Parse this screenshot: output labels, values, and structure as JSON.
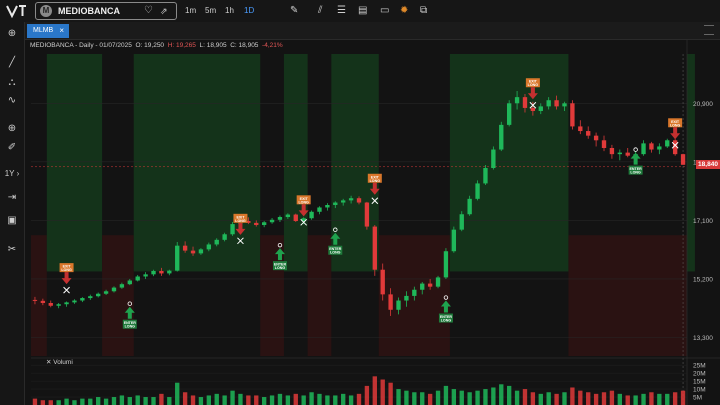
{
  "header": {
    "symbol_badge": "M",
    "symbol": "MEDIOBANCA",
    "timeframes": [
      "1m",
      "5m",
      "1h",
      "1D"
    ],
    "active_timeframe": "1D"
  },
  "tab": {
    "label": "MLMB",
    "close": "×"
  },
  "legend": {
    "name": "MEDIOBANCA - Daily - 01/07/2025",
    "open": "O: 19,250",
    "high": "H: 19,265",
    "low": "L: 18,905",
    "close": "C: 18,905",
    "change": "-4,21%"
  },
  "volume_title": "Volumi",
  "last_price": "18,840",
  "signals": {
    "exit": "EXIT LONG",
    "enter": "ENTER LONG"
  },
  "colors": {
    "up": "#1fb85a",
    "down": "#e03a3a",
    "accent": "#2a77c9",
    "long_zone": "#14331a",
    "short_zone": "#2a1212"
  },
  "chart_data": {
    "type": "candlestick",
    "title": "MEDIOBANCA - Daily",
    "y_axis_labels": [
      "20,900",
      "19,000",
      "17,100",
      "15,200",
      "13,300"
    ],
    "volume_axis_labels": [
      "25M",
      "20M",
      "15M",
      "10M",
      "5M"
    ],
    "ylim": [
      12700,
      22500
    ],
    "last_value": 18840,
    "series": {
      "candles": [
        [
          14520,
          14620,
          14380,
          14490
        ],
        [
          14490,
          14560,
          14350,
          14420
        ],
        [
          14420,
          14500,
          14280,
          14330
        ],
        [
          14330,
          14420,
          14250,
          14380
        ],
        [
          14380,
          14470,
          14300,
          14440
        ],
        [
          14440,
          14540,
          14390,
          14500
        ],
        [
          14500,
          14610,
          14450,
          14580
        ],
        [
          14580,
          14690,
          14520,
          14640
        ],
        [
          14640,
          14760,
          14600,
          14720
        ],
        [
          14720,
          14850,
          14680,
          14800
        ],
        [
          14800,
          14960,
          14760,
          14920
        ],
        [
          14920,
          15080,
          14880,
          15030
        ],
        [
          15030,
          15200,
          15000,
          15150
        ],
        [
          15150,
          15330,
          15120,
          15280
        ],
        [
          15280,
          15420,
          15200,
          15350
        ],
        [
          15350,
          15500,
          15290,
          15460
        ],
        [
          15460,
          15560,
          15300,
          15380
        ],
        [
          15380,
          15500,
          15320,
          15470
        ],
        [
          15470,
          16400,
          15440,
          16280
        ],
        [
          16280,
          16420,
          16050,
          16120
        ],
        [
          16120,
          16250,
          15950,
          16030
        ],
        [
          16030,
          16200,
          15980,
          16160
        ],
        [
          16160,
          16380,
          16100,
          16320
        ],
        [
          16320,
          16520,
          16260,
          16470
        ],
        [
          16470,
          16700,
          16420,
          16650
        ],
        [
          16650,
          17050,
          16600,
          16980
        ],
        [
          16980,
          17150,
          16900,
          17080
        ],
        [
          17080,
          17200,
          16980,
          17020
        ],
        [
          17020,
          17100,
          16900,
          16950
        ],
        [
          16950,
          17080,
          16880,
          17040
        ],
        [
          17040,
          17180,
          16990,
          17120
        ],
        [
          17120,
          17260,
          17050,
          17210
        ],
        [
          17210,
          17330,
          17150,
          17290
        ],
        [
          17290,
          17320,
          17050,
          17080
        ],
        [
          17080,
          17200,
          16980,
          17170
        ],
        [
          17170,
          17420,
          17120,
          17380
        ],
        [
          17380,
          17560,
          17300,
          17520
        ],
        [
          17520,
          17660,
          17420,
          17600
        ],
        [
          17600,
          17720,
          17500,
          17680
        ],
        [
          17680,
          17800,
          17580,
          17750
        ],
        [
          17750,
          17900,
          17650,
          17820
        ],
        [
          17820,
          17880,
          17620,
          17680
        ],
        [
          17680,
          17700,
          16800,
          16900
        ],
        [
          16900,
          16950,
          15300,
          15500
        ],
        [
          15500,
          15700,
          14500,
          14700
        ],
        [
          14700,
          14900,
          14000,
          14200
        ],
        [
          14200,
          14600,
          14050,
          14500
        ],
        [
          14500,
          14800,
          14300,
          14650
        ],
        [
          14650,
          14950,
          14500,
          14850
        ],
        [
          14850,
          15100,
          14700,
          15050
        ],
        [
          15050,
          15200,
          14850,
          14950
        ],
        [
          14950,
          15300,
          14900,
          15250
        ],
        [
          15250,
          16200,
          15200,
          16100
        ],
        [
          16100,
          16900,
          16050,
          16800
        ],
        [
          16800,
          17400,
          16750,
          17300
        ],
        [
          17300,
          17900,
          17250,
          17800
        ],
        [
          17800,
          18400,
          17750,
          18300
        ],
        [
          18300,
          18900,
          18250,
          18800
        ],
        [
          18800,
          19500,
          18750,
          19400
        ],
        [
          19400,
          20300,
          19350,
          20200
        ],
        [
          20200,
          21000,
          20150,
          20900
        ],
        [
          20900,
          21300,
          20700,
          21100
        ],
        [
          21100,
          21200,
          20600,
          20750
        ],
        [
          20750,
          20950,
          20500,
          20650
        ],
        [
          20650,
          20900,
          20550,
          20800
        ],
        [
          20800,
          21100,
          20700,
          21000
        ],
        [
          21000,
          21150,
          20700,
          20800
        ],
        [
          20800,
          20950,
          20650,
          20900
        ],
        [
          20900,
          21000,
          20050,
          20150
        ],
        [
          20150,
          20350,
          19900,
          20000
        ],
        [
          20000,
          20150,
          19750,
          19850
        ],
        [
          19850,
          19950,
          19500,
          19700
        ],
        [
          19700,
          19850,
          19350,
          19450
        ],
        [
          19450,
          19550,
          19100,
          19250
        ],
        [
          19250,
          19400,
          19050,
          19300
        ],
        [
          19300,
          19450,
          19150,
          19200
        ],
        [
          19200,
          19350,
          19100,
          19250
        ],
        [
          19250,
          19700,
          19200,
          19600
        ],
        [
          19600,
          19650,
          19300,
          19400
        ],
        [
          19400,
          19600,
          19250,
          19500
        ],
        [
          19500,
          19750,
          19450,
          19700
        ],
        [
          19700,
          19800,
          19200,
          19250
        ],
        [
          19250,
          19265,
          18905,
          18905
        ]
      ],
      "volume": [
        4,
        3,
        3,
        3,
        4,
        3,
        4,
        4,
        5,
        4,
        5,
        6,
        5,
        6,
        5,
        5,
        7,
        5,
        14,
        8,
        6,
        5,
        6,
        7,
        6,
        9,
        7,
        6,
        6,
        5,
        6,
        7,
        6,
        7,
        6,
        8,
        7,
        6,
        6,
        7,
        6,
        7,
        12,
        18,
        16,
        14,
        10,
        9,
        8,
        8,
        7,
        9,
        12,
        10,
        9,
        8,
        9,
        10,
        11,
        13,
        12,
        9,
        10,
        8,
        7,
        8,
        7,
        8,
        11,
        9,
        8,
        7,
        8,
        9,
        7,
        6,
        6,
        7,
        8,
        7,
        7,
        8,
        9,
        11
      ]
    },
    "trade_markers": [
      {
        "type": "EXIT LONG",
        "value": 15000
      },
      {
        "type": "ENTER LONG",
        "value": 14300
      },
      {
        "type": "EXIT LONG",
        "value": 16600
      },
      {
        "type": "ENTER LONG",
        "value": 16200
      },
      {
        "type": "EXIT LONG",
        "value": 17200
      },
      {
        "type": "ENTER LONG",
        "value": 16700
      },
      {
        "type": "EXIT LONG",
        "value": 17900
      },
      {
        "type": "ENTER LONG",
        "value": 14500
      },
      {
        "type": "EXIT LONG",
        "value": 21000
      },
      {
        "type": "ENTER LONG",
        "value": 19300
      },
      {
        "type": "EXIT LONG",
        "value": 19700
      }
    ],
    "volume_ylim": [
      0,
      27
    ],
    "grid": true
  }
}
